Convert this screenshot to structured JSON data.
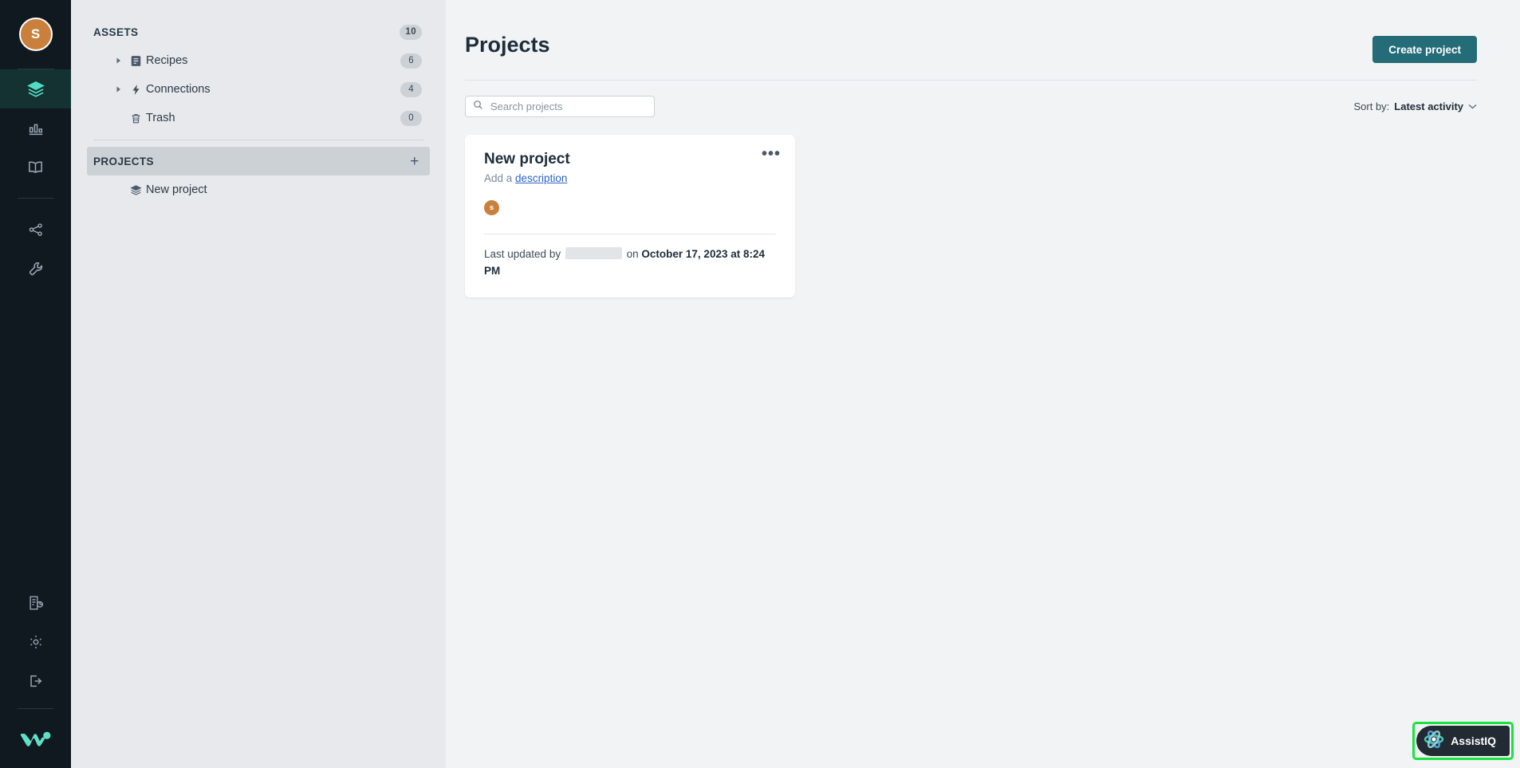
{
  "rail": {
    "avatar_initial": "S",
    "items": [
      {
        "name": "layers-icon",
        "label": "Assets",
        "active": true
      },
      {
        "name": "bar-chart-icon",
        "label": "Dashboards",
        "active": false
      },
      {
        "name": "book-icon",
        "label": "Catalog",
        "active": false
      },
      {
        "name": "share-network-icon",
        "label": "Flow",
        "active": false
      },
      {
        "name": "wrench-icon",
        "label": "Tools",
        "active": false
      },
      {
        "name": "report-icon",
        "label": "Reports",
        "active": false
      },
      {
        "name": "gear-icon",
        "label": "Settings",
        "active": false
      },
      {
        "name": "logout-icon",
        "label": "Log out",
        "active": false
      }
    ],
    "logo_name": "workato-logo"
  },
  "sidebar": {
    "assets": {
      "label": "ASSETS",
      "count": "10"
    },
    "items": [
      {
        "label": "Recipes",
        "count": "6",
        "icon": "recipe-icon",
        "caret": true
      },
      {
        "label": "Connections",
        "count": "4",
        "icon": "bolt-icon",
        "caret": true
      },
      {
        "label": "Trash",
        "count": "0",
        "icon": "trash-icon",
        "caret": false
      }
    ],
    "projects": {
      "label": "PROJECTS",
      "add_label": "+"
    },
    "project_items": [
      {
        "label": "New project",
        "icon": "layers-icon"
      }
    ]
  },
  "header": {
    "title": "Projects",
    "create_label": "Create project"
  },
  "toolbar": {
    "search_placeholder": "Search projects",
    "search_value": "",
    "sort_prefix": "Sort by:",
    "sort_value": "Latest activity"
  },
  "projects": [
    {
      "title": "New project",
      "desc_prefix": "Add a",
      "desc_link": "description",
      "avatar_initial": "s",
      "meta_prefix": "Last updated by",
      "meta_middle": "on",
      "meta_timestamp": "October 17, 2023 at 8:24 PM",
      "menu_label": "•••"
    }
  ],
  "assistiq": {
    "label": "AssistIQ",
    "icon": "atom-icon"
  },
  "colors": {
    "accent_teal": "#236c78",
    "rail_bg": "#101820",
    "rail_active_bg": "#143231",
    "rail_active_icon": "#52dcc8",
    "sidebar_bg": "#e7e9ec",
    "main_bg": "#f1f3f5",
    "avatar_bronze": "#c9803c",
    "link_blue": "#2b64c8",
    "highlight_green": "#19e33f",
    "logo_teal": "#5fe0c8"
  }
}
